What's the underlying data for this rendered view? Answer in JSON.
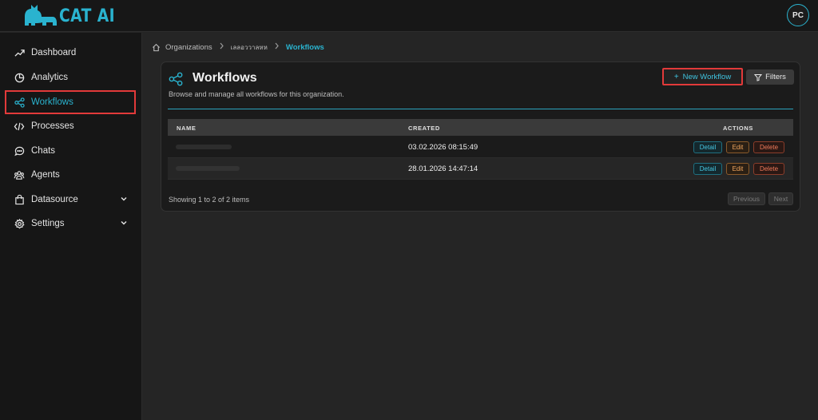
{
  "app": {
    "logo_text": "CAT AI",
    "user_initials": "PC"
  },
  "sidebar": {
    "items": [
      {
        "label": "Dashboard",
        "icon": "trend-up-icon"
      },
      {
        "label": "Analytics",
        "icon": "pie-chart-icon"
      },
      {
        "label": "Workflows",
        "icon": "share-nodes-icon",
        "active": true
      },
      {
        "label": "Processes",
        "icon": "code-icon"
      },
      {
        "label": "Chats",
        "icon": "chat-bubble-icon"
      },
      {
        "label": "Agents",
        "icon": "users-icon"
      },
      {
        "label": "Datasource",
        "icon": "shopping-bag-icon",
        "expandable": true
      },
      {
        "label": "Settings",
        "icon": "gear-icon",
        "expandable": true
      }
    ]
  },
  "breadcrumb": {
    "items": [
      "Organizations",
      "เลลอววาลหห",
      "Workflows"
    ]
  },
  "page": {
    "title": "Workflows",
    "subtitle": "Browse and manage all workflows for this organization.",
    "new_button": "New Workflow",
    "filter_button": "Filters"
  },
  "table": {
    "columns": [
      "NAME",
      "CREATED",
      "ACTIONS"
    ],
    "rows": [
      {
        "created": "03.02.2026 08:15:49"
      },
      {
        "created": "28.01.2026 14:47:14"
      }
    ],
    "actions": {
      "detail": "Detail",
      "edit": "Edit",
      "delete": "Delete"
    }
  },
  "pagination": {
    "summary": "Showing 1 to 2 of 2 items",
    "prev": "Previous",
    "next": "Next"
  },
  "colors": {
    "accent": "#2ab3cf",
    "highlight": "#e23a3a",
    "background": "#252525"
  }
}
